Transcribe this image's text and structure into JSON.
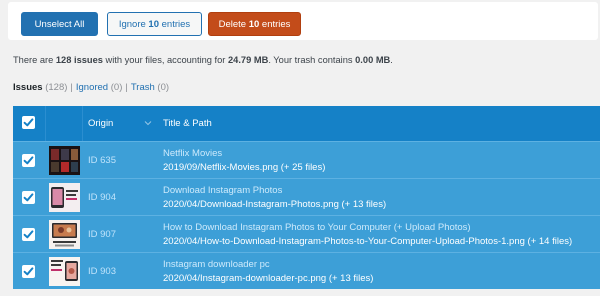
{
  "toolbar": {
    "unselect_label": "Unselect All",
    "ignore_prefix": "Ignore ",
    "ignore_count": "10",
    "ignore_suffix": " entries",
    "delete_prefix": "Delete ",
    "delete_count": "10",
    "delete_suffix": " entries"
  },
  "summary": {
    "part1": "There are ",
    "issues": "128 issues",
    "part2": " with your files, accounting for ",
    "size": "24.79 MB",
    "part3": ". Your trash contains ",
    "trash": "0.00 MB",
    "part4": "."
  },
  "filters": {
    "issues_label": "Issues",
    "issues_count": "(128)",
    "ignored_label": "Ignored",
    "ignored_count": "(0)",
    "trash_label": "Trash",
    "trash_count": "(0)",
    "separator": "|"
  },
  "table": {
    "headers": {
      "origin": "Origin",
      "title_path": "Title & Path"
    },
    "header_checked": true,
    "rows": [
      {
        "checked": true,
        "id": "ID 635",
        "title": "Netflix Movies",
        "path": "2019/09/Netflix-Movies.png (+ 25 files)",
        "thumb": "netflix"
      },
      {
        "checked": true,
        "id": "ID 904",
        "title": "Download Instagram Photos",
        "path": "2020/04/Download-Instagram-Photos.png (+ 13 files)",
        "thumb": "instagram-download"
      },
      {
        "checked": true,
        "id": "ID 907",
        "title": "How to Download Instagram Photos to Your Computer (+ Upload Photos)",
        "path": "2020/04/How-to-Download-Instagram-Photos-to-Your-Computer-Upload-Photos-1.png (+ 14 files)",
        "thumb": "instagram-computer"
      },
      {
        "checked": true,
        "id": "ID 903",
        "title": "Instagram downloader pc",
        "path": "2020/04/Instagram-downloader-pc.png (+ 13 files)",
        "thumb": "instagram-pc"
      }
    ]
  },
  "colors": {
    "primary": "#2271b1",
    "delete": "#c34c1a",
    "table_header": "#1581c7",
    "row_bg": "#3d9fd7"
  }
}
